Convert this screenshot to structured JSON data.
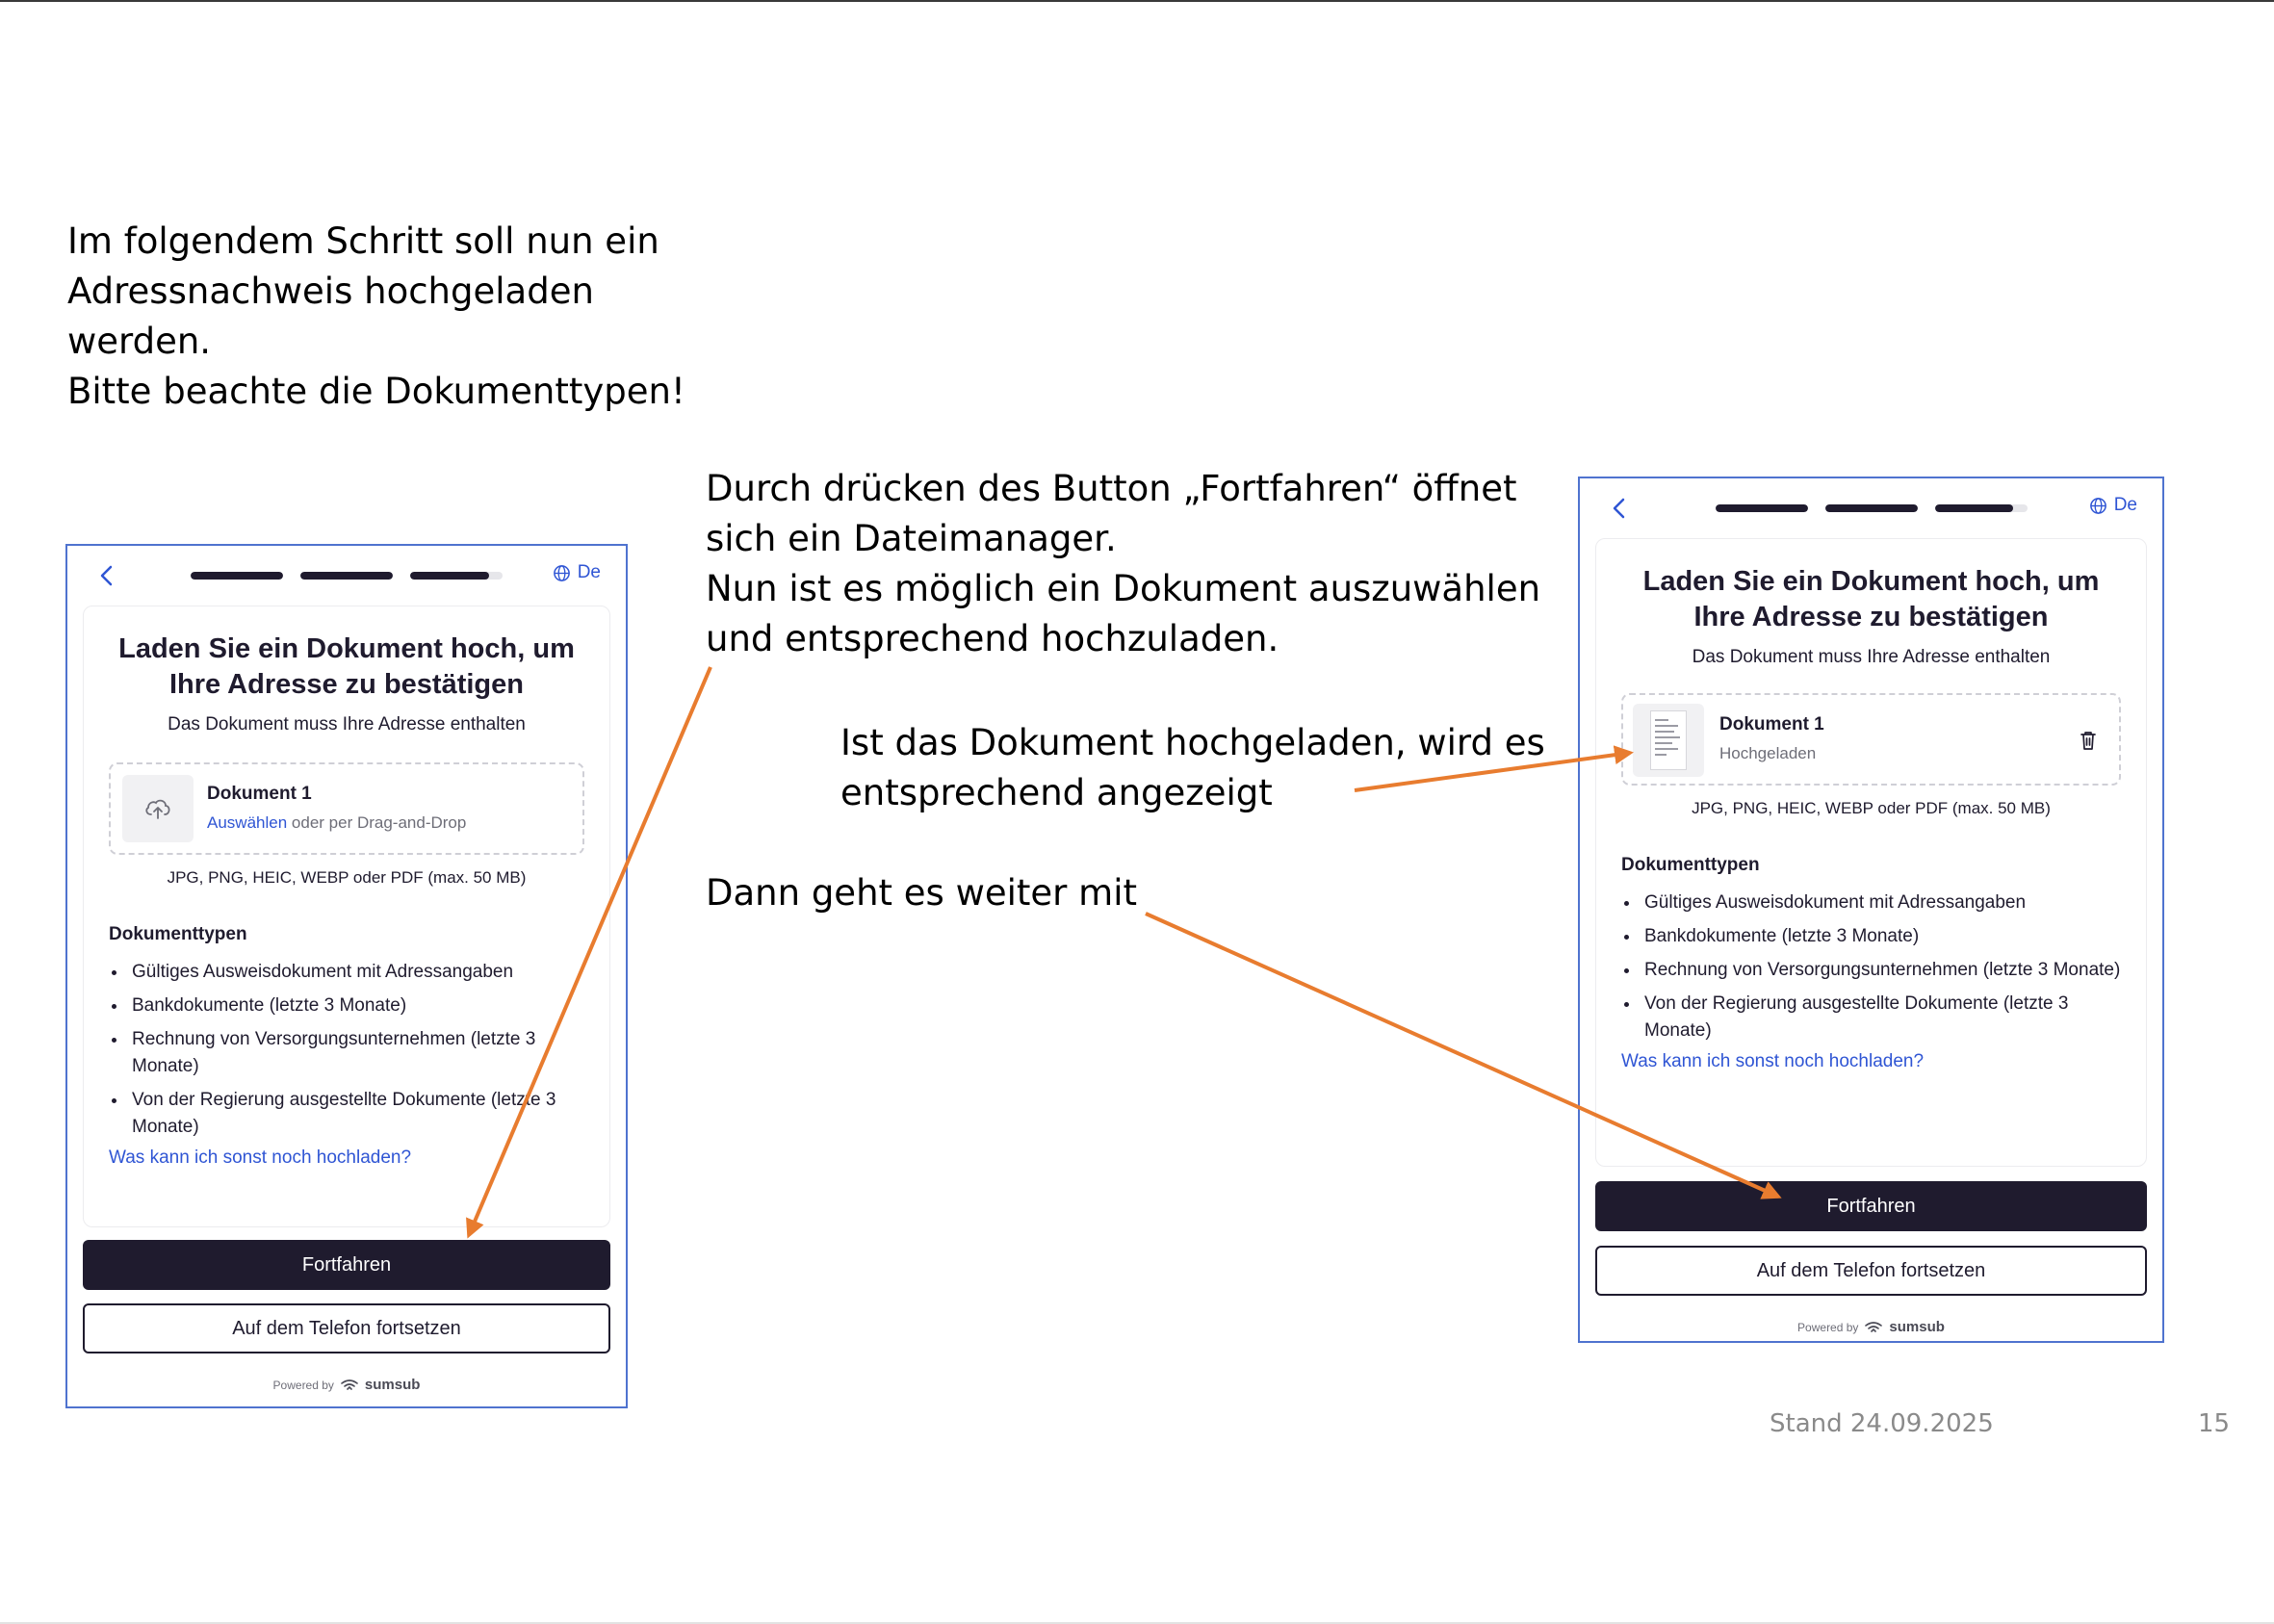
{
  "slide": {
    "intro_lines": [
      "Im folgendem Schritt soll nun ein",
      "Adressnachweis hochgeladen",
      "werden.",
      "Bitte beachte die Dokumenttypen!"
    ],
    "step_lines": [
      "Durch drücken des Button „Fortfahren“ öffnet",
      "sich ein Dateimanager.",
      "Nun ist es möglich ein Dokument auszuwählen",
      "und entsprechend hochzuladen."
    ],
    "uploaded_lines": [
      "Ist das Dokument hochgeladen, wird es",
      "entsprechend angezeigt"
    ],
    "next_line": "Dann geht es weiter mit",
    "stand": "Stand 24.09.2025",
    "page_number": "15"
  },
  "colors": {
    "accent_blue": "#2f55d4",
    "frame_blue": "#4f73cf",
    "dark_button": "#1f1b2e",
    "arrow_orange": "#e87c2f"
  },
  "phones": [
    {
      "state": "before-upload",
      "language": "De",
      "progress": [
        1,
        1,
        0.85
      ],
      "title": "Laden Sie ein Dokument hoch, um Ihre Adresse zu bestätigen",
      "subtitle": "Das Dokument muss Ihre Adresse enthalten",
      "upload": {
        "name": "Dokument 1",
        "link": "Auswählen",
        "hint": "oder per Drag-and-Drop",
        "icon": "cloud-upload-icon"
      },
      "formats": "JPG, PNG, HEIC, WEBP oder PDF (max. 50 MB)",
      "doctypes_title": "Dokumenttypen",
      "doctypes": [
        "Gültiges Ausweisdokument mit Adressangaben",
        "Bankdokumente (letzte 3 Monate)",
        "Rechnung von Versorgungsunternehmen (letzte 3 Monate)",
        "Von der Regierung ausgestellte Dokumente (letzte 3 Monate)"
      ],
      "more_link": "Was kann ich sonst noch hochladen?",
      "continue_label": "Fortfahren",
      "phone_label": "Auf dem Telefon fortsetzen",
      "powered_by": "Powered by",
      "brand": "sumsub"
    },
    {
      "state": "uploaded",
      "language": "De",
      "progress": [
        1,
        1,
        0.85
      ],
      "title": "Laden Sie ein Dokument hoch, um Ihre Adresse zu bestätigen",
      "subtitle": "Das Dokument muss Ihre Adresse enthalten",
      "upload": {
        "name": "Dokument 1",
        "status": "Hochgeladen",
        "icon": "document-thumbnail",
        "action_icon": "trash-icon"
      },
      "formats": "JPG, PNG, HEIC, WEBP oder PDF (max. 50 MB)",
      "doctypes_title": "Dokumenttypen",
      "doctypes": [
        "Gültiges Ausweisdokument mit Adressangaben",
        "Bankdokumente (letzte 3 Monate)",
        "Rechnung von Versorgungsunternehmen (letzte 3 Monate)",
        "Von der Regierung ausgestellte Dokumente (letzte 3 Monate)"
      ],
      "more_link": "Was kann ich sonst noch hochladen?",
      "continue_label": "Fortfahren",
      "phone_label": "Auf dem Telefon fortsetzen",
      "powered_by": "Powered by",
      "brand": "sumsub"
    }
  ]
}
